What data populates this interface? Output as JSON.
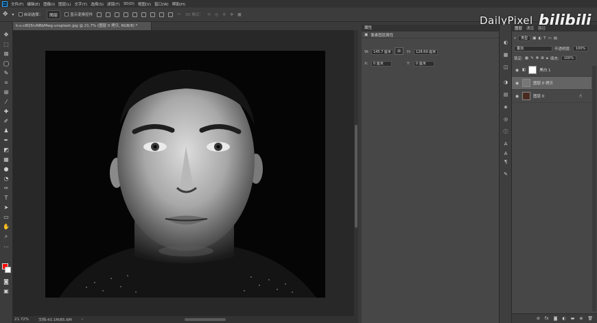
{
  "menubar": {
    "items": [
      "文件(F)",
      "编辑(E)",
      "图像(I)",
      "图层(L)",
      "文字(Y)",
      "选择(S)",
      "滤镜(T)",
      "3D(D)",
      "视图(V)",
      "窗口(W)",
      "帮助(H)"
    ]
  },
  "options_bar": {
    "auto_select_label": "自动选择：",
    "auto_select_value": "图层",
    "show_transform_label": "显示变换控件",
    "mode_3d_label": "3D 模式："
  },
  "document": {
    "tab_title": "k-u-c8Q5ivNBbMwg-unsplash.jpg @ 21.7% (图层 0 拷贝, RGB/8) *"
  },
  "status_bar": {
    "zoom": "21.72%",
    "doc_info": "文档:43.1M/85.6M"
  },
  "properties": {
    "tab_label": "属性",
    "subtitle": "像素图层属性",
    "w_label": "W:",
    "w_value": "145.7 厘米",
    "h_label": "H:",
    "h_value": "128.69 厘米",
    "x_label": "X:",
    "x_value": "0 厘米",
    "y_label": "Y:",
    "y_value": "0 厘米"
  },
  "layers_panel": {
    "tabs": [
      "图层",
      "通道",
      "路径"
    ],
    "filter_kind": "类型",
    "blend_mode": "叠加",
    "opacity_label": "不透明度:",
    "opacity_value": "100%",
    "lock_label": "锁定:",
    "fill_label": "填充:",
    "fill_value": "100%",
    "layers": [
      {
        "name": "黑白 1",
        "selected": false
      },
      {
        "name": "图层 0 拷贝",
        "selected": true
      },
      {
        "name": "图层 0",
        "selected": false
      }
    ]
  },
  "watermark": {
    "brand": "DailyPixel",
    "site": "bilibili"
  },
  "colors": {
    "foreground": "#ff0000",
    "background": "#ffffff",
    "panel": "#474747",
    "canvas_bg": "#282828"
  }
}
